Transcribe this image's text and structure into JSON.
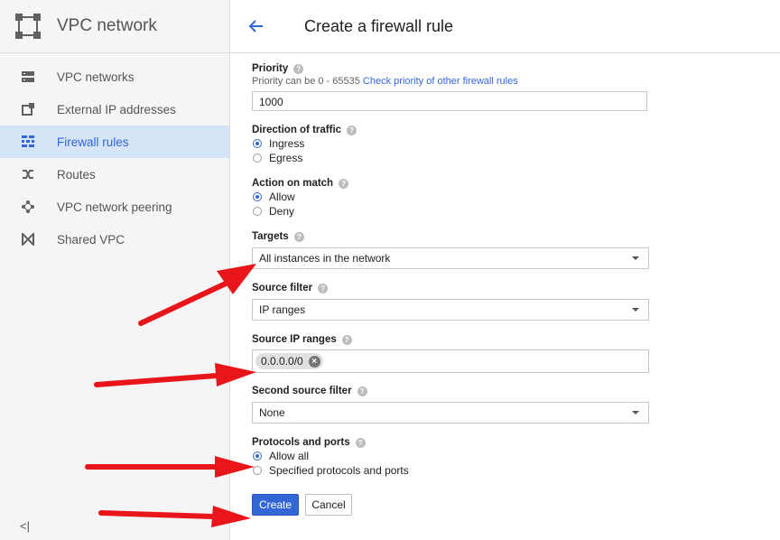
{
  "sidebar": {
    "title": "VPC network",
    "items": [
      {
        "label": "VPC networks",
        "icon": "vpc-networks-icon",
        "active": false
      },
      {
        "label": "External IP addresses",
        "icon": "external-ip-icon",
        "active": false
      },
      {
        "label": "Firewall rules",
        "icon": "firewall-icon",
        "active": true
      },
      {
        "label": "Routes",
        "icon": "routes-icon",
        "active": false
      },
      {
        "label": "VPC network peering",
        "icon": "peering-icon",
        "active": false
      },
      {
        "label": "Shared VPC",
        "icon": "shared-vpc-icon",
        "active": false
      }
    ],
    "collapse_label": "<|"
  },
  "header": {
    "title": "Create a firewall rule"
  },
  "form": {
    "priority": {
      "label": "Priority",
      "hint": "Priority can be 0 - 65535",
      "hint_link": "Check priority of other firewall rules",
      "value": "1000"
    },
    "direction": {
      "label": "Direction of traffic",
      "options": [
        "Ingress",
        "Egress"
      ],
      "selected": "Ingress"
    },
    "action": {
      "label": "Action on match",
      "options": [
        "Allow",
        "Deny"
      ],
      "selected": "Allow"
    },
    "targets": {
      "label": "Targets",
      "value": "All instances in the network"
    },
    "source_filter": {
      "label": "Source filter",
      "value": "IP ranges"
    },
    "source_ranges": {
      "label": "Source IP ranges",
      "chips": [
        "0.0.0.0/0"
      ]
    },
    "second_filter": {
      "label": "Second source filter",
      "value": "None"
    },
    "protocols": {
      "label": "Protocols and ports",
      "options": [
        "Allow all",
        "Specified protocols and ports"
      ],
      "selected": "Allow all"
    },
    "create_label": "Create",
    "cancel_label": "Cancel"
  },
  "colors": {
    "accent": "#3367d6",
    "annotation_arrow": "#e8161b",
    "active_nav_bg": "#d6e4f7"
  }
}
